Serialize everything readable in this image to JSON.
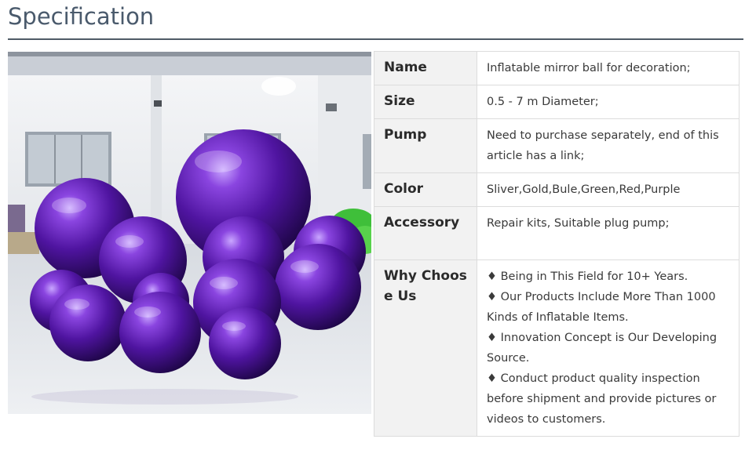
{
  "heading": "Specification",
  "image": {
    "subject": "photo-of-purple-inflatable-mirror-balls",
    "colors": {
      "ball": "#5a1aa8",
      "ball_dark": "#2a0a5c",
      "ball_light": "#b58cf0",
      "wall": "#eef0f2",
      "floor": "#dfe3e8"
    }
  },
  "rows": [
    {
      "key": "Name",
      "value": "Inflatable mirror ball for decoration;"
    },
    {
      "key": "Size",
      "value": "0.5 - 7 m Diameter;"
    },
    {
      "key": "Pump",
      "value": "Need to purchase separately, end of this article has a link;"
    },
    {
      "key": "Color",
      "value": "Sliver,Gold,Bule,Green,Red,Purple"
    },
    {
      "key": "Accessory",
      "value": "Repair kits, Suitable plug pump;"
    }
  ],
  "why": {
    "key": "Why Choose Us",
    "lines": [
      "♦ Being in This Field for 10+ Years.",
      "♦ Our Products Include More Than 1000 Kinds of Inflatable Items.",
      "♦ Innovation Concept is Our Developing Source.",
      "♦ Conduct product quality inspection before shipment and provide pictures or videos to customers."
    ]
  },
  "colors": {
    "heading": "#4a5a6c",
    "rule": "#4f5b66",
    "key_bg": "#f2f2f2",
    "border": "#dcdcdc"
  }
}
